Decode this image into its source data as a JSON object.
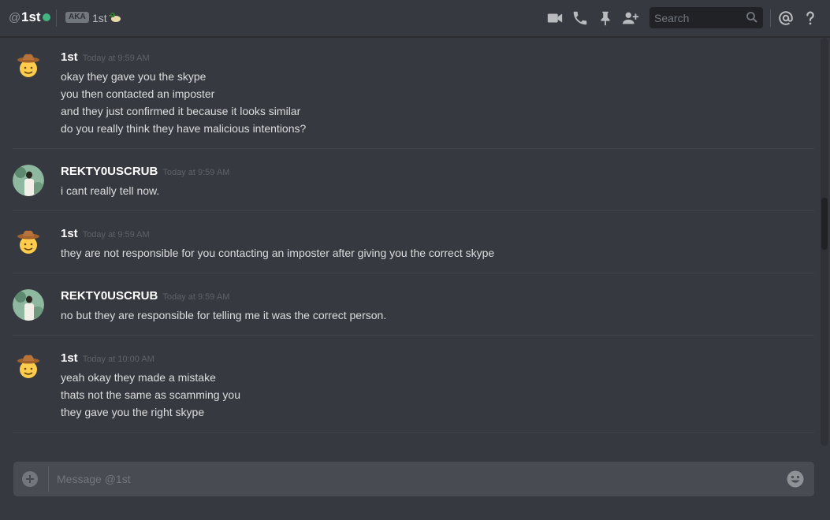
{
  "header": {
    "at_symbol": "@",
    "channel_name": "1st",
    "aka_badge": "AKA",
    "aka_name": "1st",
    "status": "online",
    "status_color": "#43b581",
    "icons": [
      "video-call-icon",
      "phone-icon",
      "pin-icon",
      "add-friend-icon"
    ],
    "search_placeholder": "Search",
    "mention_icon": "at-icon",
    "help_icon": "help-icon"
  },
  "messages": [
    {
      "author": "1st",
      "timestamp": "Today at 9:59 AM",
      "avatar": "cowboy-emoji",
      "lines": [
        "okay they gave you the skype",
        "you then contacted an imposter",
        "and they just confirmed it because it looks similar",
        "do you really think they have malicious intentions?"
      ]
    },
    {
      "author": "REKTY0USCRUB",
      "timestamp": "Today at 9:59 AM",
      "avatar": "photo-avatar",
      "lines": [
        "i cant really tell now."
      ]
    },
    {
      "author": "1st",
      "timestamp": "Today at 9:59 AM",
      "avatar": "cowboy-emoji",
      "lines": [
        "they are not responsible for you contacting an imposter after giving you the correct skype"
      ]
    },
    {
      "author": "REKTY0USCRUB",
      "timestamp": "Today at 9:59 AM",
      "avatar": "photo-avatar",
      "lines": [
        "no but they are responsible for telling me it was the correct person."
      ]
    },
    {
      "author": "1st",
      "timestamp": "Today at 10:00 AM",
      "avatar": "cowboy-emoji",
      "lines": [
        "yeah okay they made a mistake",
        "thats not the same as scamming you",
        "they gave you the right skype"
      ]
    }
  ],
  "composer": {
    "placeholder": "Message @1st",
    "value": ""
  },
  "colors": {
    "background": "#36393f",
    "composer": "#484b51",
    "online": "#43b581"
  }
}
